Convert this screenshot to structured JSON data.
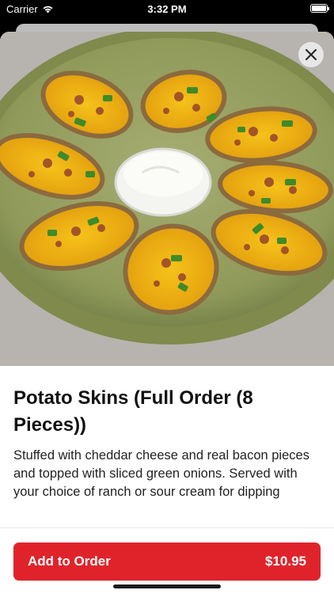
{
  "status_bar": {
    "carrier": "Carrier",
    "time": "3:32 PM"
  },
  "product": {
    "image_alt": "Potato skins topped with cheddar cheese, bacon and green onions with a cup of sour cream",
    "title": "Potato Skins (Full Order (8 Pieces))",
    "description": "Stuffed with cheddar cheese and real bacon pieces and topped with sliced green onions. Served with your choice of ranch or sour cream for dipping"
  },
  "order_button": {
    "label": "Add to Order",
    "price": "$10.95"
  },
  "icons": {
    "close": "close-icon",
    "wifi": "wifi-icon",
    "battery": "battery-icon"
  },
  "colors": {
    "accent": "#e0232b"
  }
}
